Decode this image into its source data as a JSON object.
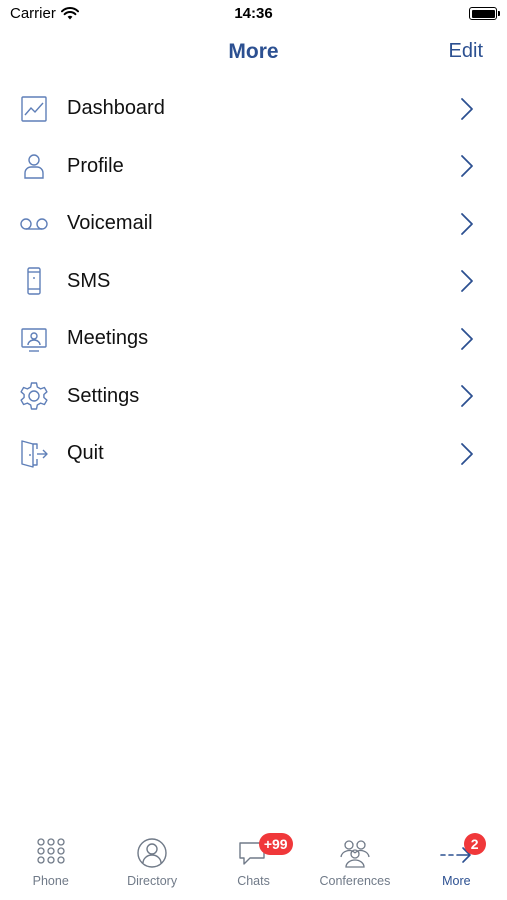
{
  "status_bar": {
    "carrier": "Carrier",
    "time": "14:36",
    "battery_level": 1.0
  },
  "nav": {
    "title": "More",
    "edit_label": "Edit"
  },
  "menu": {
    "items": [
      {
        "label": "Dashboard",
        "icon": "dashboard-chart-icon"
      },
      {
        "label": "Profile",
        "icon": "person-icon"
      },
      {
        "label": "Voicemail",
        "icon": "voicemail-icon"
      },
      {
        "label": "SMS",
        "icon": "mobile-phone-icon"
      },
      {
        "label": "Meetings",
        "icon": "meetings-monitor-icon"
      },
      {
        "label": "Settings",
        "icon": "gear-icon"
      },
      {
        "label": "Quit",
        "icon": "exit-door-icon"
      }
    ]
  },
  "tabs": [
    {
      "label": "Phone",
      "icon": "keypad-icon",
      "active": false
    },
    {
      "label": "Directory",
      "icon": "directory-person-icon",
      "active": false
    },
    {
      "label": "Chats",
      "icon": "chat-bubble-icon",
      "active": false,
      "badge": "+99"
    },
    {
      "label": "Conferences",
      "icon": "group-icon",
      "active": false
    },
    {
      "label": "More",
      "icon": "more-arrow-icon",
      "active": true,
      "badge": "2"
    }
  ],
  "colors": {
    "accent": "#2c5091",
    "icon_stroke": "#5f7fb8",
    "tab_inactive": "#707a88",
    "badge": "#f0383a",
    "chevron": "#2c5091"
  }
}
